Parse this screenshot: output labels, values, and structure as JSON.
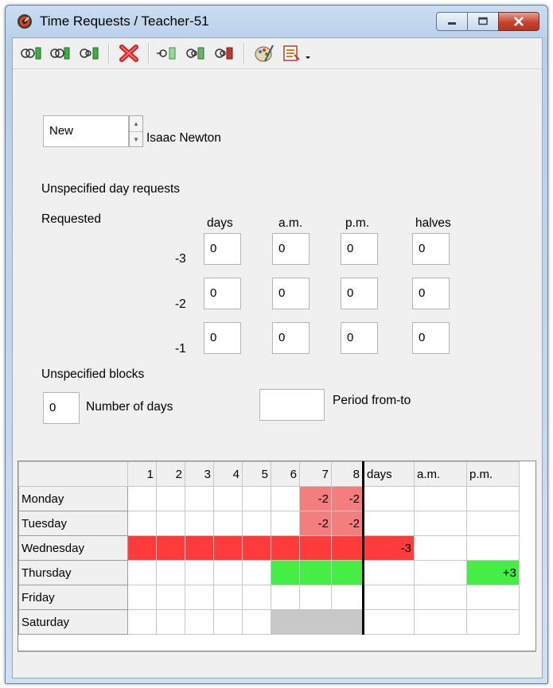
{
  "window": {
    "title": "Time Requests / Teacher-51"
  },
  "toolbar": {
    "icons": [
      "rooms-arrow-icon",
      "double-arrow-icon",
      "single-arrow-icon",
      "delete-icon",
      "move-left-icon",
      "move-left2-icon",
      "move-left3-icon",
      "palette-icon",
      "list-icon",
      "dropdown-icon"
    ]
  },
  "header": {
    "selector_value": "New",
    "teacher_name": "Isaac Newton"
  },
  "unspecified_day": {
    "section_label": "Unspecified day requests",
    "requested_label": "Requested",
    "columns": [
      "days",
      "a.m.",
      "p.m.",
      "halves"
    ],
    "rows": [
      {
        "label": "-3",
        "values": [
          "0",
          "0",
          "0",
          "0"
        ]
      },
      {
        "label": "-2",
        "values": [
          "0",
          "0",
          "0",
          "0"
        ]
      },
      {
        "label": "-1",
        "values": [
          "0",
          "0",
          "0",
          "0"
        ]
      }
    ]
  },
  "unspecified_blocks": {
    "section_label": "Unspecified blocks",
    "days_value": "0",
    "days_label": "Number of days",
    "period_value": "",
    "period_label": "Period from-to"
  },
  "grid": {
    "period_headers": [
      "1",
      "2",
      "3",
      "4",
      "5",
      "6",
      "7",
      "8"
    ],
    "extra_headers": [
      "days",
      "a.m.",
      "p.m."
    ],
    "rows": [
      {
        "day": "Monday",
        "cells": [
          "",
          "",
          "",
          "",
          "",
          "",
          "-2",
          "-2"
        ],
        "extra": [
          "",
          "",
          ""
        ]
      },
      {
        "day": "Tuesday",
        "cells": [
          "",
          "",
          "",
          "",
          "",
          "",
          "-2",
          "-2"
        ],
        "extra": [
          "",
          "",
          ""
        ]
      },
      {
        "day": "Wednesday",
        "cells": [
          "",
          "",
          "",
          "",
          "",
          "",
          "",
          ""
        ],
        "extra": [
          "-3",
          "",
          ""
        ]
      },
      {
        "day": "Thursday",
        "cells": [
          "",
          "",
          "",
          "",
          "",
          "",
          "",
          ""
        ],
        "extra": [
          "",
          "",
          "+3"
        ]
      },
      {
        "day": "Friday",
        "cells": [
          "",
          "",
          "",
          "",
          "",
          "",
          "",
          ""
        ],
        "extra": [
          "",
          "",
          ""
        ]
      },
      {
        "day": "Saturday",
        "cells": [
          "",
          "",
          "",
          "",
          "",
          "",
          "",
          ""
        ],
        "extra": [
          "",
          "",
          ""
        ]
      }
    ],
    "colors": {
      "red": "#ff3b3b",
      "light_red": "#f47e7e",
      "green": "#44ee44",
      "gray": "#c8c8c8"
    }
  }
}
